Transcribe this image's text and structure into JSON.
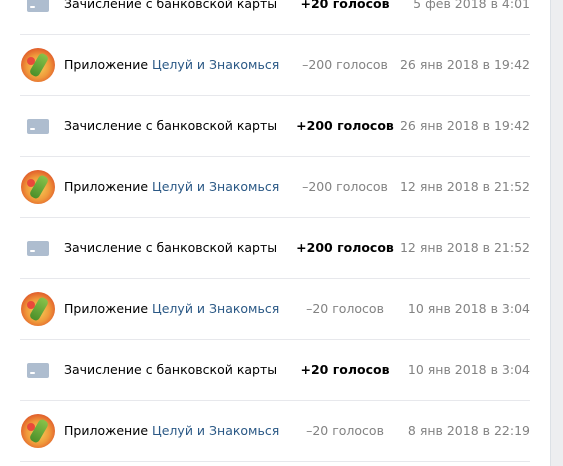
{
  "transactions": [
    {
      "type": "card",
      "icon": "card-icon",
      "prefix": "Зачисление с банковской карты",
      "link": "",
      "amount": "+20 голосов",
      "sign": "pos",
      "date": "5 фев 2018 в 4:01"
    },
    {
      "type": "app",
      "icon": "app-icon",
      "prefix": "Приложение",
      "link": "Целуй и Знакомься",
      "amount": "–200 голосов",
      "sign": "neg",
      "date": "26 янв 2018 в 19:42"
    },
    {
      "type": "card",
      "icon": "card-icon",
      "prefix": "Зачисление с банковской карты",
      "link": "",
      "amount": "+200 голосов",
      "sign": "pos",
      "date": "26 янв 2018 в 19:42"
    },
    {
      "type": "app",
      "icon": "app-icon",
      "prefix": "Приложение",
      "link": "Целуй и Знакомься",
      "amount": "–200 голосов",
      "sign": "neg",
      "date": "12 янв 2018 в 21:52"
    },
    {
      "type": "card",
      "icon": "card-icon",
      "prefix": "Зачисление с банковской карты",
      "link": "",
      "amount": "+200 голосов",
      "sign": "pos",
      "date": "12 янв 2018 в 21:52"
    },
    {
      "type": "app",
      "icon": "app-icon",
      "prefix": "Приложение",
      "link": "Целуй и Знакомься",
      "amount": "–20 голосов",
      "sign": "neg",
      "date": "10 янв 2018 в 3:04"
    },
    {
      "type": "card",
      "icon": "card-icon",
      "prefix": "Зачисление с банковской карты",
      "link": "",
      "amount": "+20 голосов",
      "sign": "pos",
      "date": "10 янв 2018 в 3:04"
    },
    {
      "type": "app",
      "icon": "app-icon",
      "prefix": "Приложение",
      "link": "Целуй и Знакомься",
      "amount": "–20 голосов",
      "sign": "neg",
      "date": "8 янв 2018 в 22:19"
    }
  ]
}
